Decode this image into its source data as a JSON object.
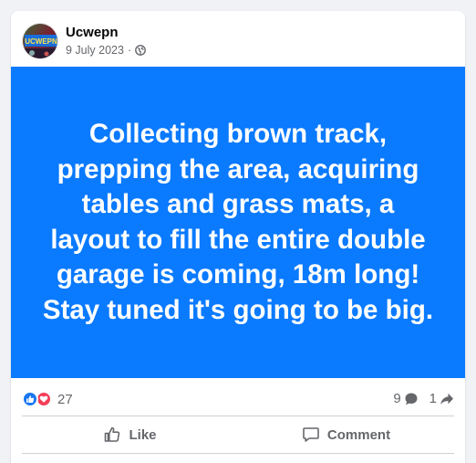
{
  "colors": {
    "page_background": "#f0f2f5",
    "post_background": "#0a7aff",
    "post_text": "#ffffff",
    "secondary_text": "#65676b",
    "like_blue": "#1877f2",
    "love_red": "#f33e58"
  },
  "post": {
    "author": "Ucwepn",
    "avatar_text": "UCWEPN",
    "date": "9 July 2023",
    "separator": "·",
    "audience_icon": "globe-icon",
    "text": "Collecting brown track, prepping the area, acquiring tables and grass mats, a layout to fill the entire double garage is coming, 18m long! Stay tuned it's going to be big."
  },
  "stats": {
    "reaction_icons": [
      "like-icon",
      "love-icon"
    ],
    "reactions_count": "27",
    "comments_count": "9",
    "shares_count": "1"
  },
  "actions": {
    "like_label": "Like",
    "comment_label": "Comment"
  }
}
